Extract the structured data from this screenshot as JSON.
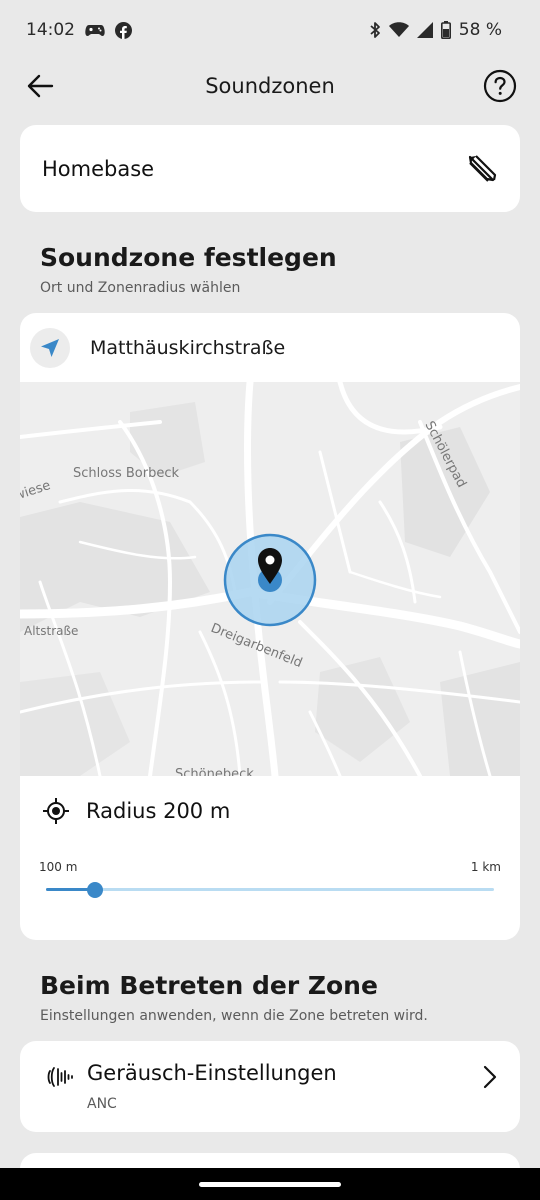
{
  "status": {
    "time": "14:02",
    "battery": "58 %"
  },
  "header": {
    "title": "Soundzonen"
  },
  "zone": {
    "name": "Homebase"
  },
  "soundzone": {
    "title": "Soundzone festlegen",
    "subtitle": "Ort und Zonenradius wählen",
    "location": "Matthäuskirchstraße",
    "map_labels": {
      "schloss": "Schloss Borbeck",
      "scholerpad": "Schölerpad",
      "wiese": "wiese",
      "altstrasse": "Altstraße",
      "dreigarbenfeld": "Dreigarbenfeld",
      "schonebeck": "Schönebeck"
    },
    "radius_label": "Radius 200 m",
    "slider_min": "100 m",
    "slider_max": "1 km",
    "slider_fraction": 0.11
  },
  "enter": {
    "title": "Beim Betreten der Zone",
    "subtitle": "Einstellungen anwenden, wenn die Zone betreten wird."
  },
  "settings": {
    "title": "Geräusch-Einstellungen",
    "value": "ANC"
  },
  "colors": {
    "accent": "#3a88c8",
    "zone_fill": "#a9d3f0"
  }
}
